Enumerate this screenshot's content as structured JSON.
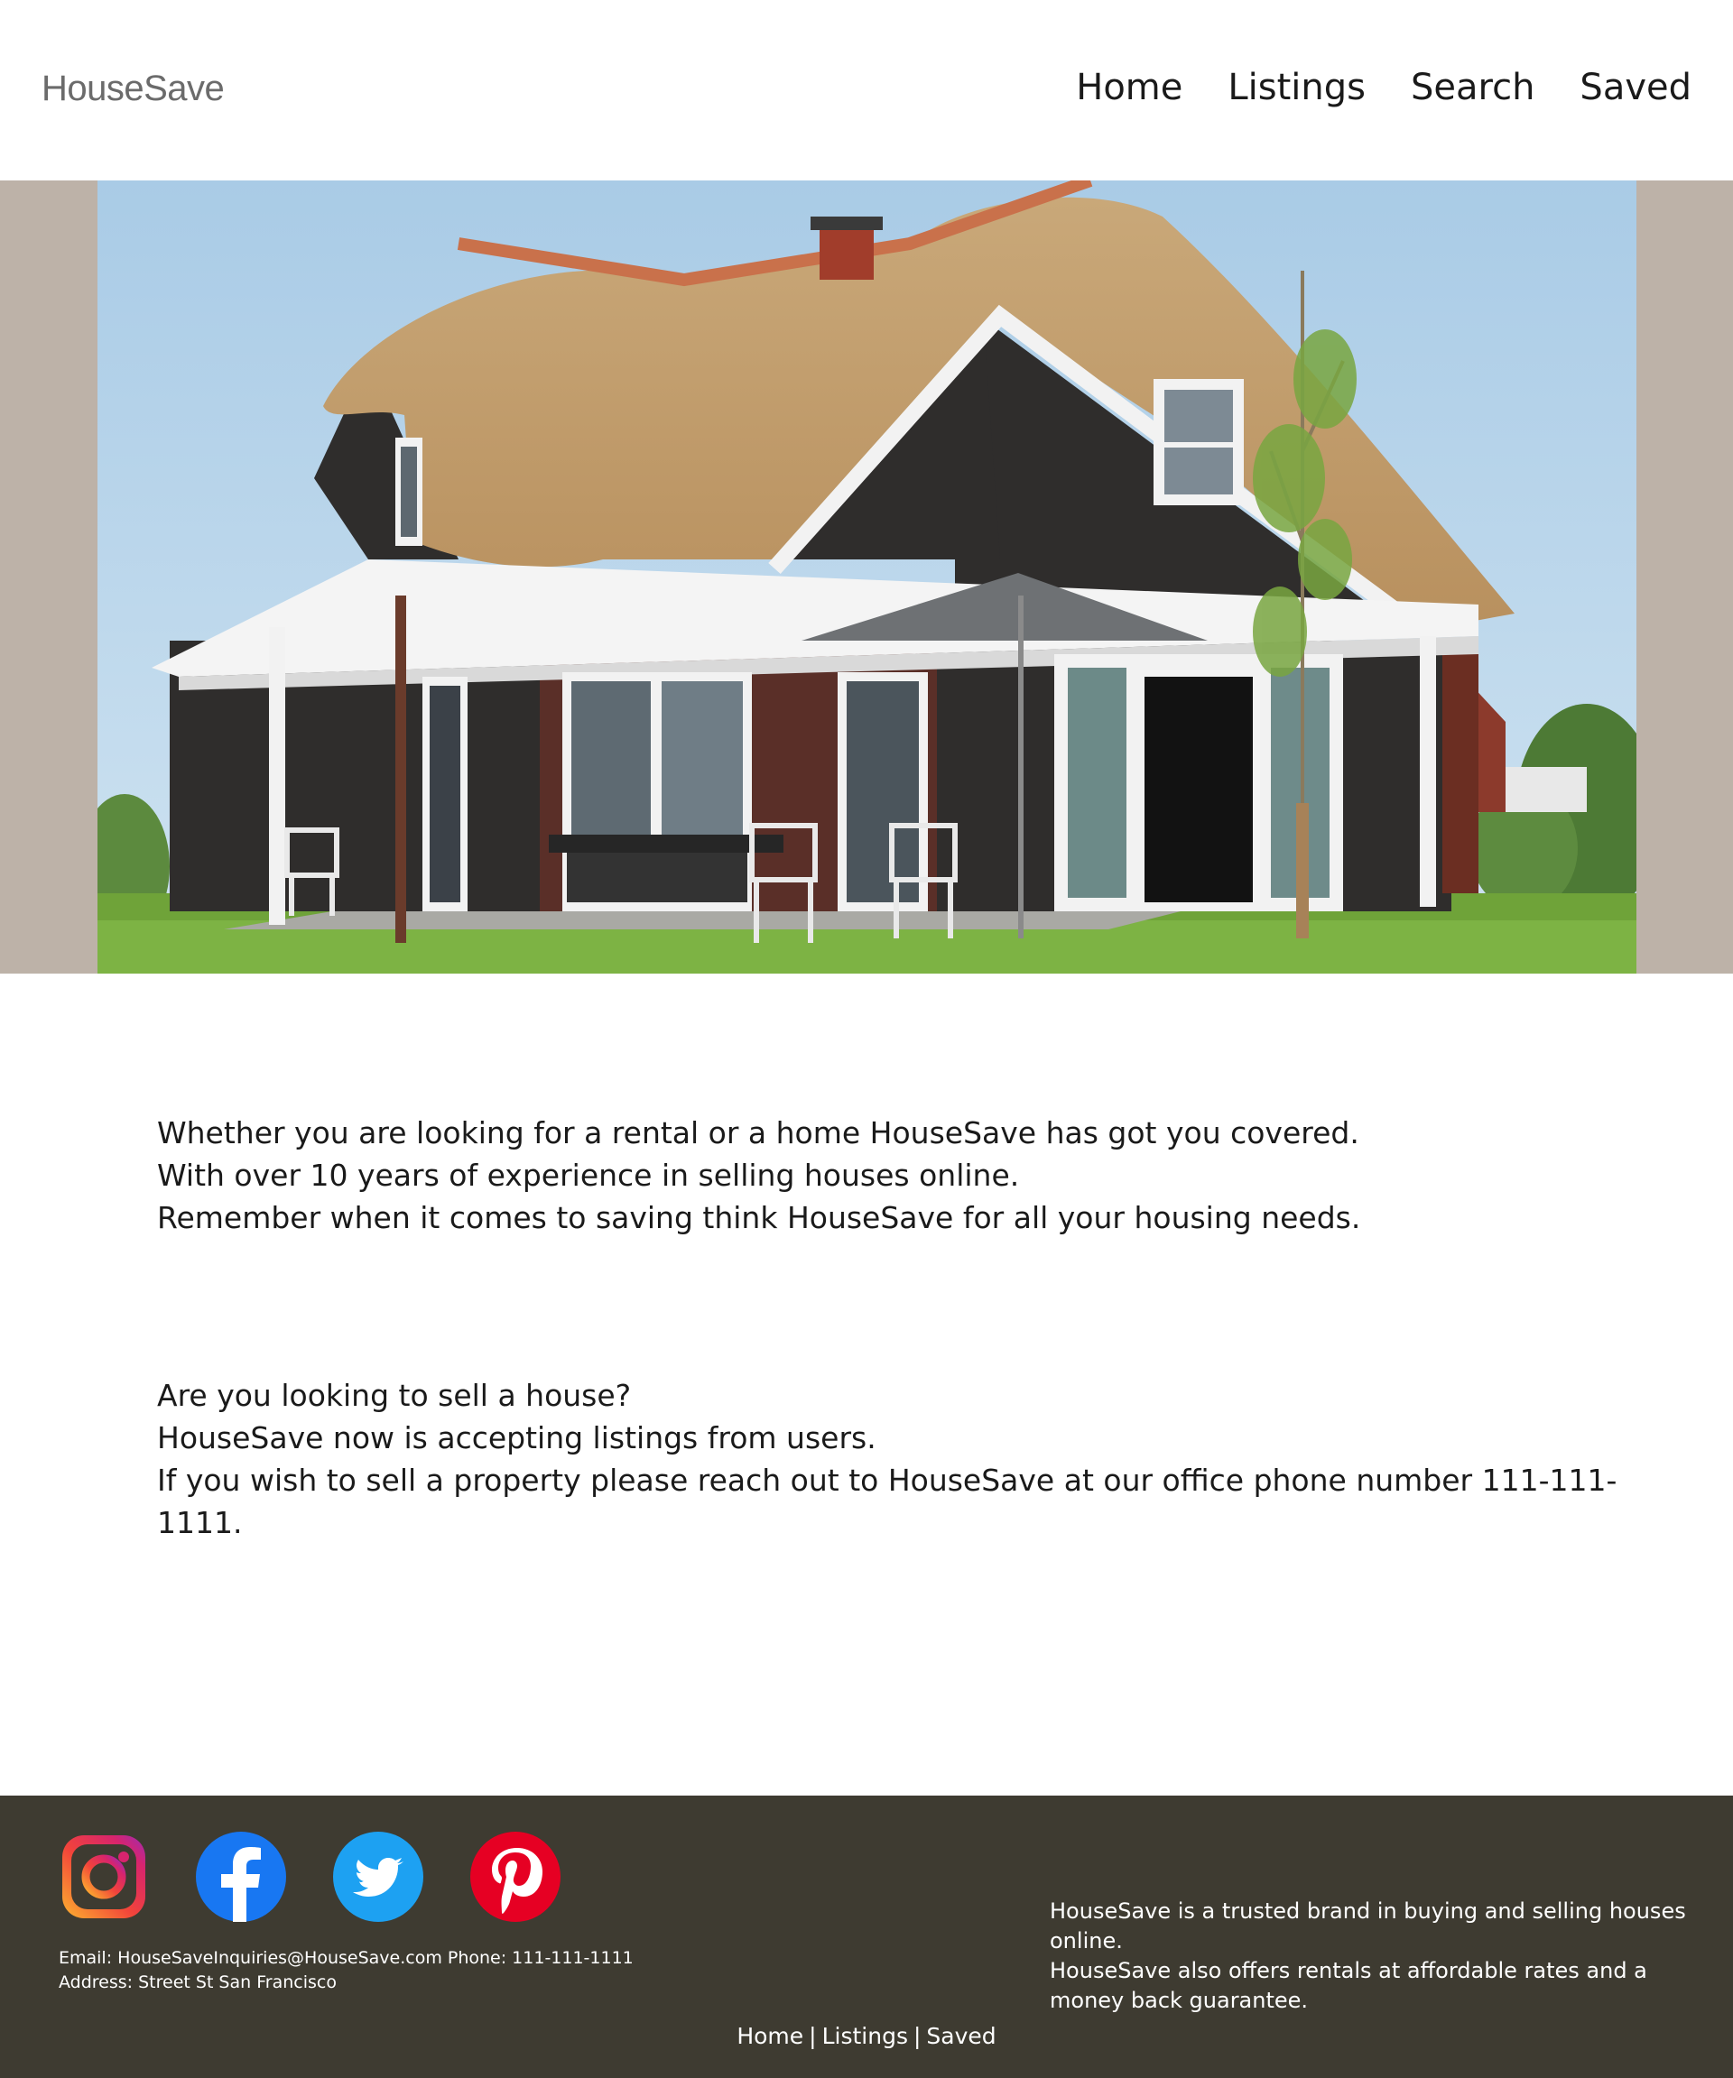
{
  "header": {
    "logo": "HouseSave",
    "nav": [
      {
        "label": "Home"
      },
      {
        "label": "Listings"
      },
      {
        "label": "Search"
      },
      {
        "label": "Saved"
      }
    ]
  },
  "intro": {
    "lines": [
      "Whether you are looking for a rental or a home HouseSave has got you covered.",
      "With over 10 years of experience in selling houses online.",
      "Remember when it comes to saving think HouseSave for all your housing needs."
    ]
  },
  "sell": {
    "lines": [
      "Are you looking to sell a house?",
      "HouseSave now is accepting listings from users.",
      "If you wish to sell a property please reach out to HouseSave at our office phone number 111-111-1111."
    ]
  },
  "footer": {
    "socials": [
      {
        "icon": "instagram-icon"
      },
      {
        "icon": "facebook-icon"
      },
      {
        "icon": "twitter-icon"
      },
      {
        "icon": "pinterest-icon"
      }
    ],
    "contact_line": "Email: HouseSaveInquiries@HouseSave.com Phone: 111-111-1111",
    "address_line": "Address: Street St San Francisco",
    "about": [
      "HouseSave is a trusted brand in buying and selling houses online.",
      "HouseSave also offers rentals at affordable rates and a money back guarantee."
    ],
    "links": [
      {
        "label": "Home"
      },
      {
        "label": "Listings"
      },
      {
        "label": "Saved"
      }
    ],
    "separator": "|"
  },
  "colors": {
    "footer_bg": "#3e3b31",
    "hero_band": "#bdb2a8",
    "instagram": "#e1306c",
    "facebook": "#1877f2",
    "twitter": "#1da1f2",
    "pinterest": "#e60023"
  }
}
